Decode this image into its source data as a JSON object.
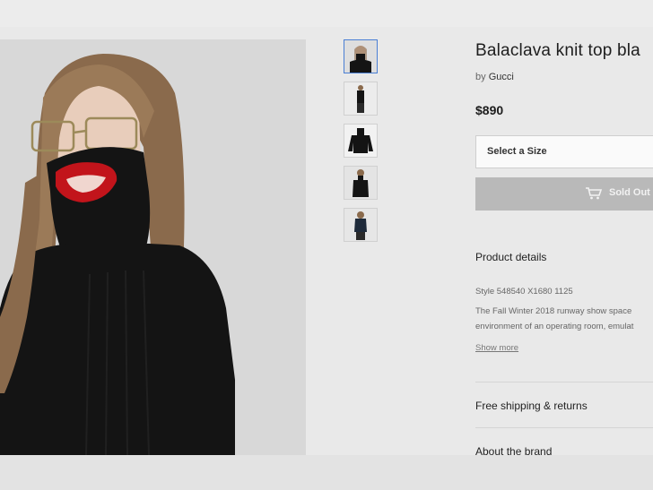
{
  "product": {
    "title": "Balaclava knit top bla",
    "by_prefix": "by",
    "brand": "Gucci",
    "price": "$890"
  },
  "purchase": {
    "size_select_label": "Select a Size",
    "sold_out_label": "Sold Out"
  },
  "sections": {
    "product_details_title": "Product details",
    "style_line": "Style 548540 X1680 1125",
    "description_line1": "The Fall Winter 2018 runway show space",
    "description_line2": "environment of an operating room, emulat",
    "show_more": "Show more",
    "free_shipping": "Free shipping & returns",
    "about_brand": "About the brand"
  },
  "thumbnails": [
    {
      "name": "thumbnail-1",
      "icon": "model-face-icon",
      "active": true
    },
    {
      "name": "thumbnail-2",
      "icon": "model-full-body-icon",
      "active": false
    },
    {
      "name": "thumbnail-3",
      "icon": "sweater-flat-icon",
      "active": false
    },
    {
      "name": "thumbnail-4",
      "icon": "model-torso-icon",
      "active": false
    },
    {
      "name": "thumbnail-5",
      "icon": "model-back-icon",
      "active": false
    }
  ],
  "colors": {
    "sweater": "#141414",
    "mouth_cutout": "#c2141b",
    "hair": "#8a6a4c",
    "active_thumb_border": "#4a7fd4",
    "sold_out_bg": "#b9b9b9"
  }
}
